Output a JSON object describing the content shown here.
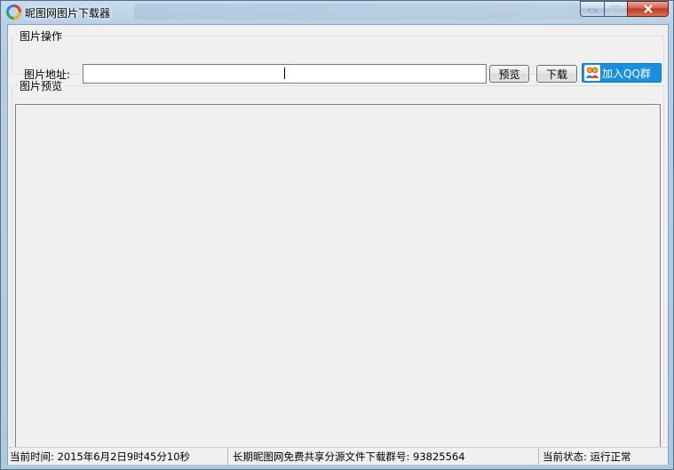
{
  "window": {
    "title": "昵图网图片下载器"
  },
  "ops_group": {
    "legend": "图片操作",
    "url_label": "图片地址:",
    "url_value": "",
    "preview_button": "预览",
    "download_button": "下载",
    "qq_button": "加入QQ群"
  },
  "preview_group": {
    "legend": "图片预览"
  },
  "statusbar": {
    "time": "当前时间: 2015年6月2日9时45分10秒",
    "group": "长期昵图网免费共享分源文件下载群号: 93825564",
    "state": "当前状态: 运行正常"
  },
  "colors": {
    "qq_button_bg": "#1a8fde",
    "close_button": "#c0391e"
  }
}
